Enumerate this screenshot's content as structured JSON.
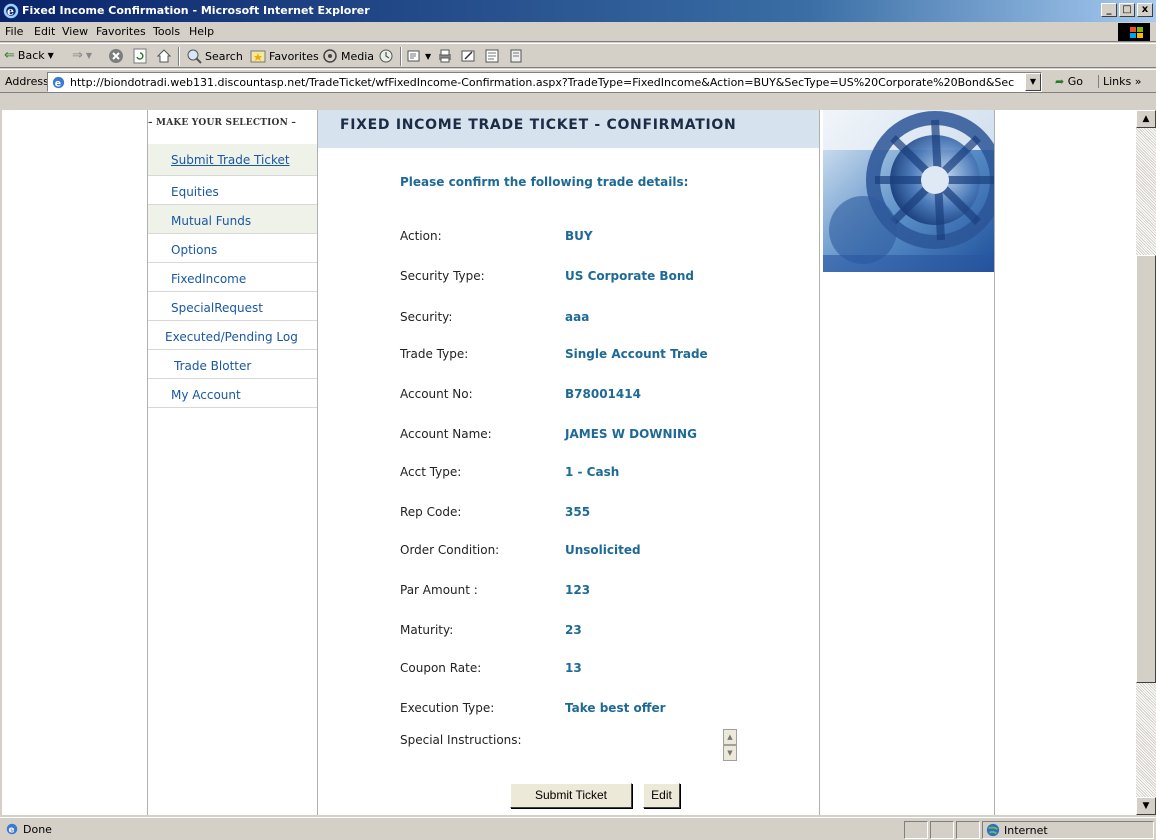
{
  "window": {
    "title": "Fixed Income Confirmation - Microsoft Internet Explorer",
    "controls": [
      "_",
      "□",
      "x"
    ]
  },
  "menu": [
    "File",
    "Edit",
    "View",
    "Favorites",
    "Tools",
    "Help"
  ],
  "toolbar": {
    "back": "Back",
    "search": "Search",
    "favorites": "Favorites",
    "media": "Media"
  },
  "address": {
    "label": "Address",
    "url": "http://biondotradi.web131.discountasp.net/TradeTicket/wfFixedIncome-Confirmation.aspx?TradeType=FixedIncome&Action=BUY&SecType=US%20Corporate%20Bond&Sec",
    "go": "Go",
    "links": "Links"
  },
  "sidebar": {
    "heading": "– MAKE YOUR SELECTION –",
    "items": [
      "Submit Trade Ticket",
      "Equities",
      "Mutual Funds",
      "Options",
      "FixedIncome",
      "SpecialRequest",
      "Executed/Pending Log",
      "Trade Blotter",
      "My Account"
    ]
  },
  "main": {
    "heading": "FIXED INCOME TRADE TICKET - CONFIRMATION",
    "subheading": "Please confirm the following trade details:",
    "rows": [
      {
        "label": "Action:",
        "value": "BUY"
      },
      {
        "label": "Security Type:",
        "value": "US Corporate Bond"
      },
      {
        "label": "Security:",
        "value": "aaa"
      },
      {
        "label": "Trade Type:",
        "value": "Single Account Trade"
      },
      {
        "label": "Account No:",
        "value": "B78001414"
      },
      {
        "label": "Account Name:",
        "value": "JAMES W DOWNING"
      },
      {
        "label": "Acct Type:",
        "value": "1 - Cash"
      },
      {
        "label": "Rep Code:",
        "value": "355"
      },
      {
        "label": "Order Condition:",
        "value": "Unsolicited"
      },
      {
        "label": "Par Amount :",
        "value": "123"
      },
      {
        "label": "Maturity:",
        "value": "23"
      },
      {
        "label": "Coupon Rate:",
        "value": "13"
      },
      {
        "label": "Execution Type:",
        "value": "Take best offer"
      }
    ],
    "special_instructions_label": "Special Instructions:",
    "submit_label": "Submit Ticket",
    "edit_label": "Edit"
  },
  "status": {
    "text": "Done",
    "zone": "Internet"
  }
}
